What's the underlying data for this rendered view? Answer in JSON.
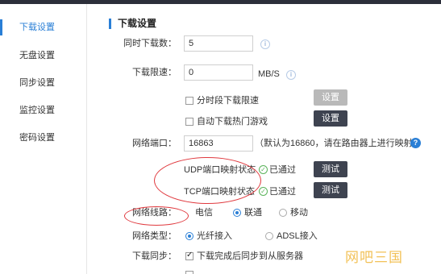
{
  "sidebar": {
    "items": [
      {
        "label": "下载设置",
        "active": true
      },
      {
        "label": "无盘设置",
        "active": false
      },
      {
        "label": "同步设置",
        "active": false
      },
      {
        "label": "监控设置",
        "active": false
      },
      {
        "label": "密码设置",
        "active": false
      }
    ]
  },
  "section": {
    "title": "下载设置"
  },
  "form": {
    "concurrent": {
      "label": "同时下载数：",
      "value": "5"
    },
    "speed_limit": {
      "label": "下载限速：",
      "value": "0",
      "unit": "MB/S"
    },
    "period_limit": {
      "label": "分时段下载限速",
      "checked": false,
      "button": "设置",
      "button_disabled": true
    },
    "auto_hot": {
      "label": "自动下载热门游戏",
      "checked": false,
      "button": "设置"
    },
    "port": {
      "label": "网络端口：",
      "value": "16863",
      "hint": "（默认为16860，请在路由器上进行映射）"
    },
    "udp": {
      "label": "UDP端口映射状态",
      "status": "已通过",
      "button": "测试"
    },
    "tcp": {
      "label": "TCP端口映射状态",
      "status": "已通过",
      "button": "测试"
    },
    "line": {
      "label": "网络线路：",
      "options": [
        "电信",
        "联通",
        "移动"
      ],
      "selected": "联通"
    },
    "net_type": {
      "label": "网络类型：",
      "options": [
        "光纤接入",
        "ADSL接入"
      ],
      "selected": "光纤接入"
    },
    "sync": {
      "label": "下载同步：",
      "option": "下载完成后同步到从服务器",
      "checked": true
    }
  },
  "watermark": "网吧三国",
  "colors": {
    "accent": "#2a7fd6",
    "dark_button": "#3e4350",
    "annotation": "#e0393e",
    "ok": "#5ab35a"
  }
}
